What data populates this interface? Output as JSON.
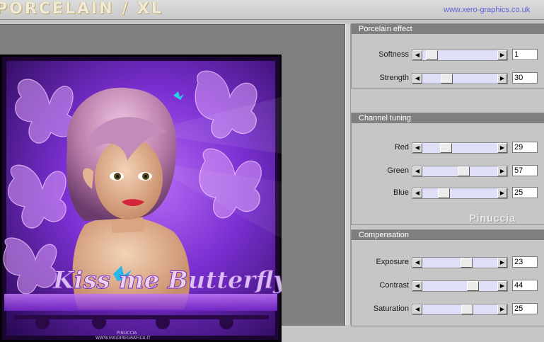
{
  "header": {
    "title": "PORCELAIN / XL",
    "website": "www.xero-graphics.co.uk"
  },
  "preview": {
    "artwork_text": "Kiss me Butterfly",
    "artwork_credit_1": "PINUCCIA",
    "artwork_credit_2": "WWW.MAIDIREGRAFICA.IT"
  },
  "panels": [
    {
      "title": "Porcelain effect",
      "controls": [
        {
          "label": "Softness",
          "value": "1",
          "fraction": 0.06
        },
        {
          "label": "Strength",
          "value": "30",
          "fraction": 0.3
        }
      ]
    },
    {
      "title": "Channel tuning",
      "controls": [
        {
          "label": "Red",
          "value": "29",
          "fraction": 0.29
        },
        {
          "label": "Green",
          "value": "57",
          "fraction": 0.57
        },
        {
          "label": "Blue",
          "value": "25",
          "fraction": 0.25
        }
      ],
      "watermark": "Pinuccia"
    },
    {
      "title": "Compensation",
      "controls": [
        {
          "label": "Exposure",
          "value": "23",
          "fraction": 0.62
        },
        {
          "label": "Contrast",
          "value": "44",
          "fraction": 0.72
        },
        {
          "label": "Saturation",
          "value": "25",
          "fraction": 0.63
        }
      ]
    }
  ],
  "colors": {
    "panel_header": "#7f7f7f",
    "slider_track": "#dfe0f7",
    "website_link": "#5a63d8"
  },
  "icons": {
    "arrow_left": "arrow-left-icon",
    "arrow_right": "arrow-right-icon"
  }
}
